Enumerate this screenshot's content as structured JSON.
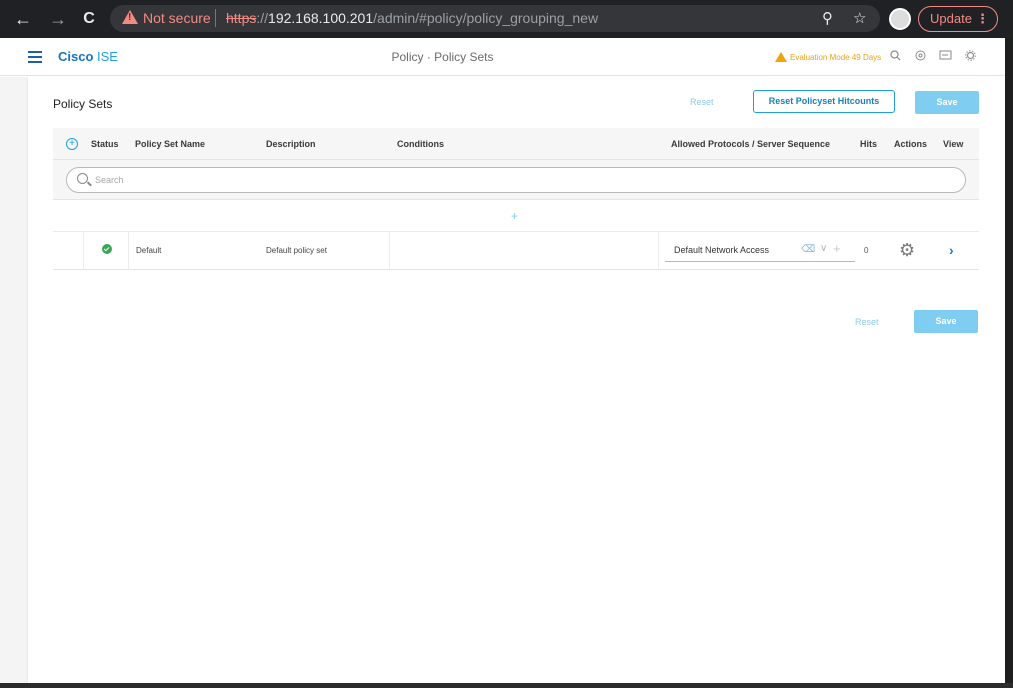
{
  "browser": {
    "back_glyph": "←",
    "forward_glyph": "→",
    "reload_glyph": "C",
    "security_label": "Not secure",
    "url_scheme": "https",
    "url_sep": "://",
    "url_host": "192.168.100.201",
    "url_path": "/admin/#policy/policy_grouping_new",
    "zoom_glyph": "⚲",
    "star_glyph": "☆",
    "update_label": "Update",
    "menu_glyph": "⋮"
  },
  "header": {
    "brand_cisco": "Cisco",
    "brand_product": " ISE",
    "page_title": "Policy · Policy Sets",
    "eval_text": "Evaluation Mode 49 Days",
    "icons": [
      "search-icon",
      "help-icon",
      "notifications-icon",
      "gear-icon"
    ]
  },
  "toolbar": {
    "section_title": "Policy Sets",
    "reset_label": "Reset",
    "reset_hitcounts_label": "Reset Policyset Hitcounts",
    "save_label": "Save"
  },
  "table": {
    "columns": {
      "status": "Status",
      "name": "Policy Set Name",
      "description": "Description",
      "conditions": "Conditions",
      "protocols": "Allowed Protocols / Server Sequence",
      "hits": "Hits",
      "actions": "Actions",
      "view": "View"
    },
    "search_placeholder": "Search",
    "add_row_glyph": "+",
    "rows": [
      {
        "name": "Default",
        "description": "Default policy set",
        "conditions": "",
        "protocol": "Default Network Access",
        "hits": "0"
      }
    ]
  },
  "footer": {
    "reset_label": "Reset",
    "save_label": "Save"
  },
  "colors": {
    "accent": "#1fa0d6",
    "save_bg": "#7fcdf0",
    "status_ok": "#3aa655",
    "warning": "#f0a30a"
  }
}
